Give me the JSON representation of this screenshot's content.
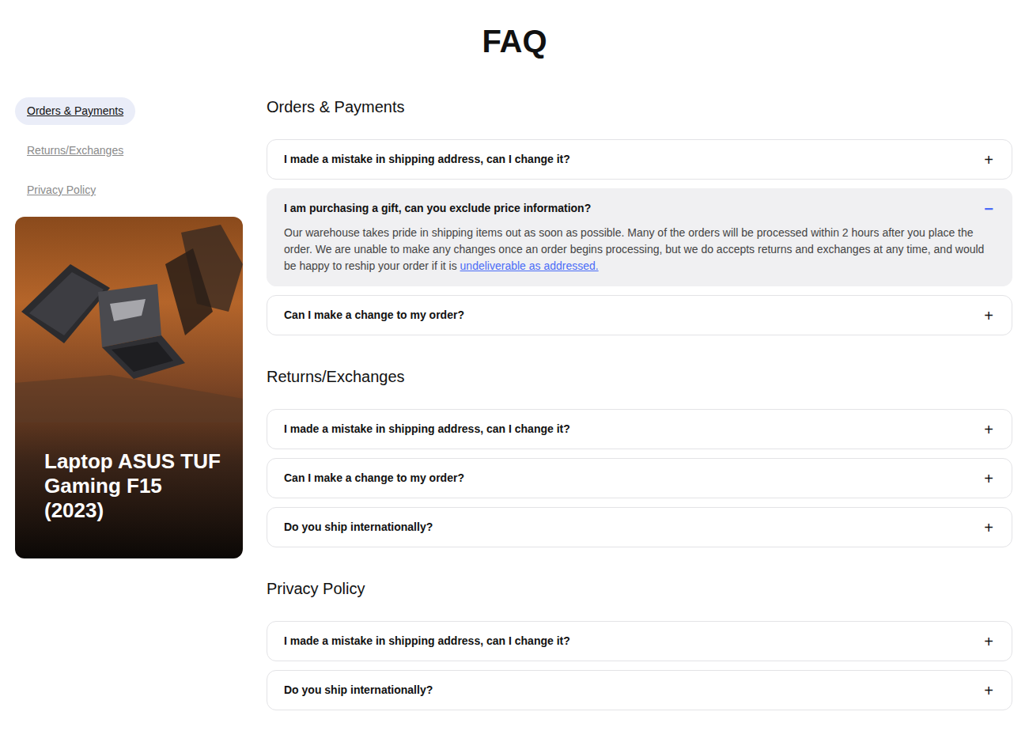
{
  "page": {
    "title": "FAQ"
  },
  "sidebar": {
    "items": [
      {
        "label": "Orders & Payments",
        "selected": true
      },
      {
        "label": "Returns/Exchanges",
        "selected": false
      },
      {
        "label": "Privacy Policy",
        "selected": false
      }
    ]
  },
  "promo": {
    "title": "Laptop ASUS TUF Gaming F15 (2023)"
  },
  "sections": [
    {
      "title": "Orders & Payments",
      "items": [
        {
          "question": "I made a mistake in shipping address, can I change it?",
          "expanded": false,
          "icon": "+"
        },
        {
          "question": "I am purchasing a gift, can you exclude price information?",
          "expanded": true,
          "icon": "−",
          "answer": "Our warehouse takes pride in shipping items out as soon as possible. Many of the orders will be processed within 2 hours after you place the order. We are unable to make any changes once an order begins processing, but we do accepts returns and exchanges at any time, and would be happy to reship your order if it is ",
          "answer_link": "undeliverable as addressed."
        },
        {
          "question": "Can I make a change to my order?",
          "expanded": false,
          "icon": "+"
        }
      ]
    },
    {
      "title": "Returns/Exchanges",
      "items": [
        {
          "question": "I made a mistake in shipping address, can I change it?",
          "expanded": false,
          "icon": "+"
        },
        {
          "question": "Can I make a change to my order?",
          "expanded": false,
          "icon": "+"
        },
        {
          "question": "Do you ship internationally?",
          "expanded": false,
          "icon": "+"
        }
      ]
    },
    {
      "title": "Privacy Policy",
      "items": [
        {
          "question": "I made a mistake in shipping address, can I change it?",
          "expanded": false,
          "icon": "+"
        },
        {
          "question": "Do you ship internationally?",
          "expanded": false,
          "icon": "+"
        }
      ]
    }
  ]
}
